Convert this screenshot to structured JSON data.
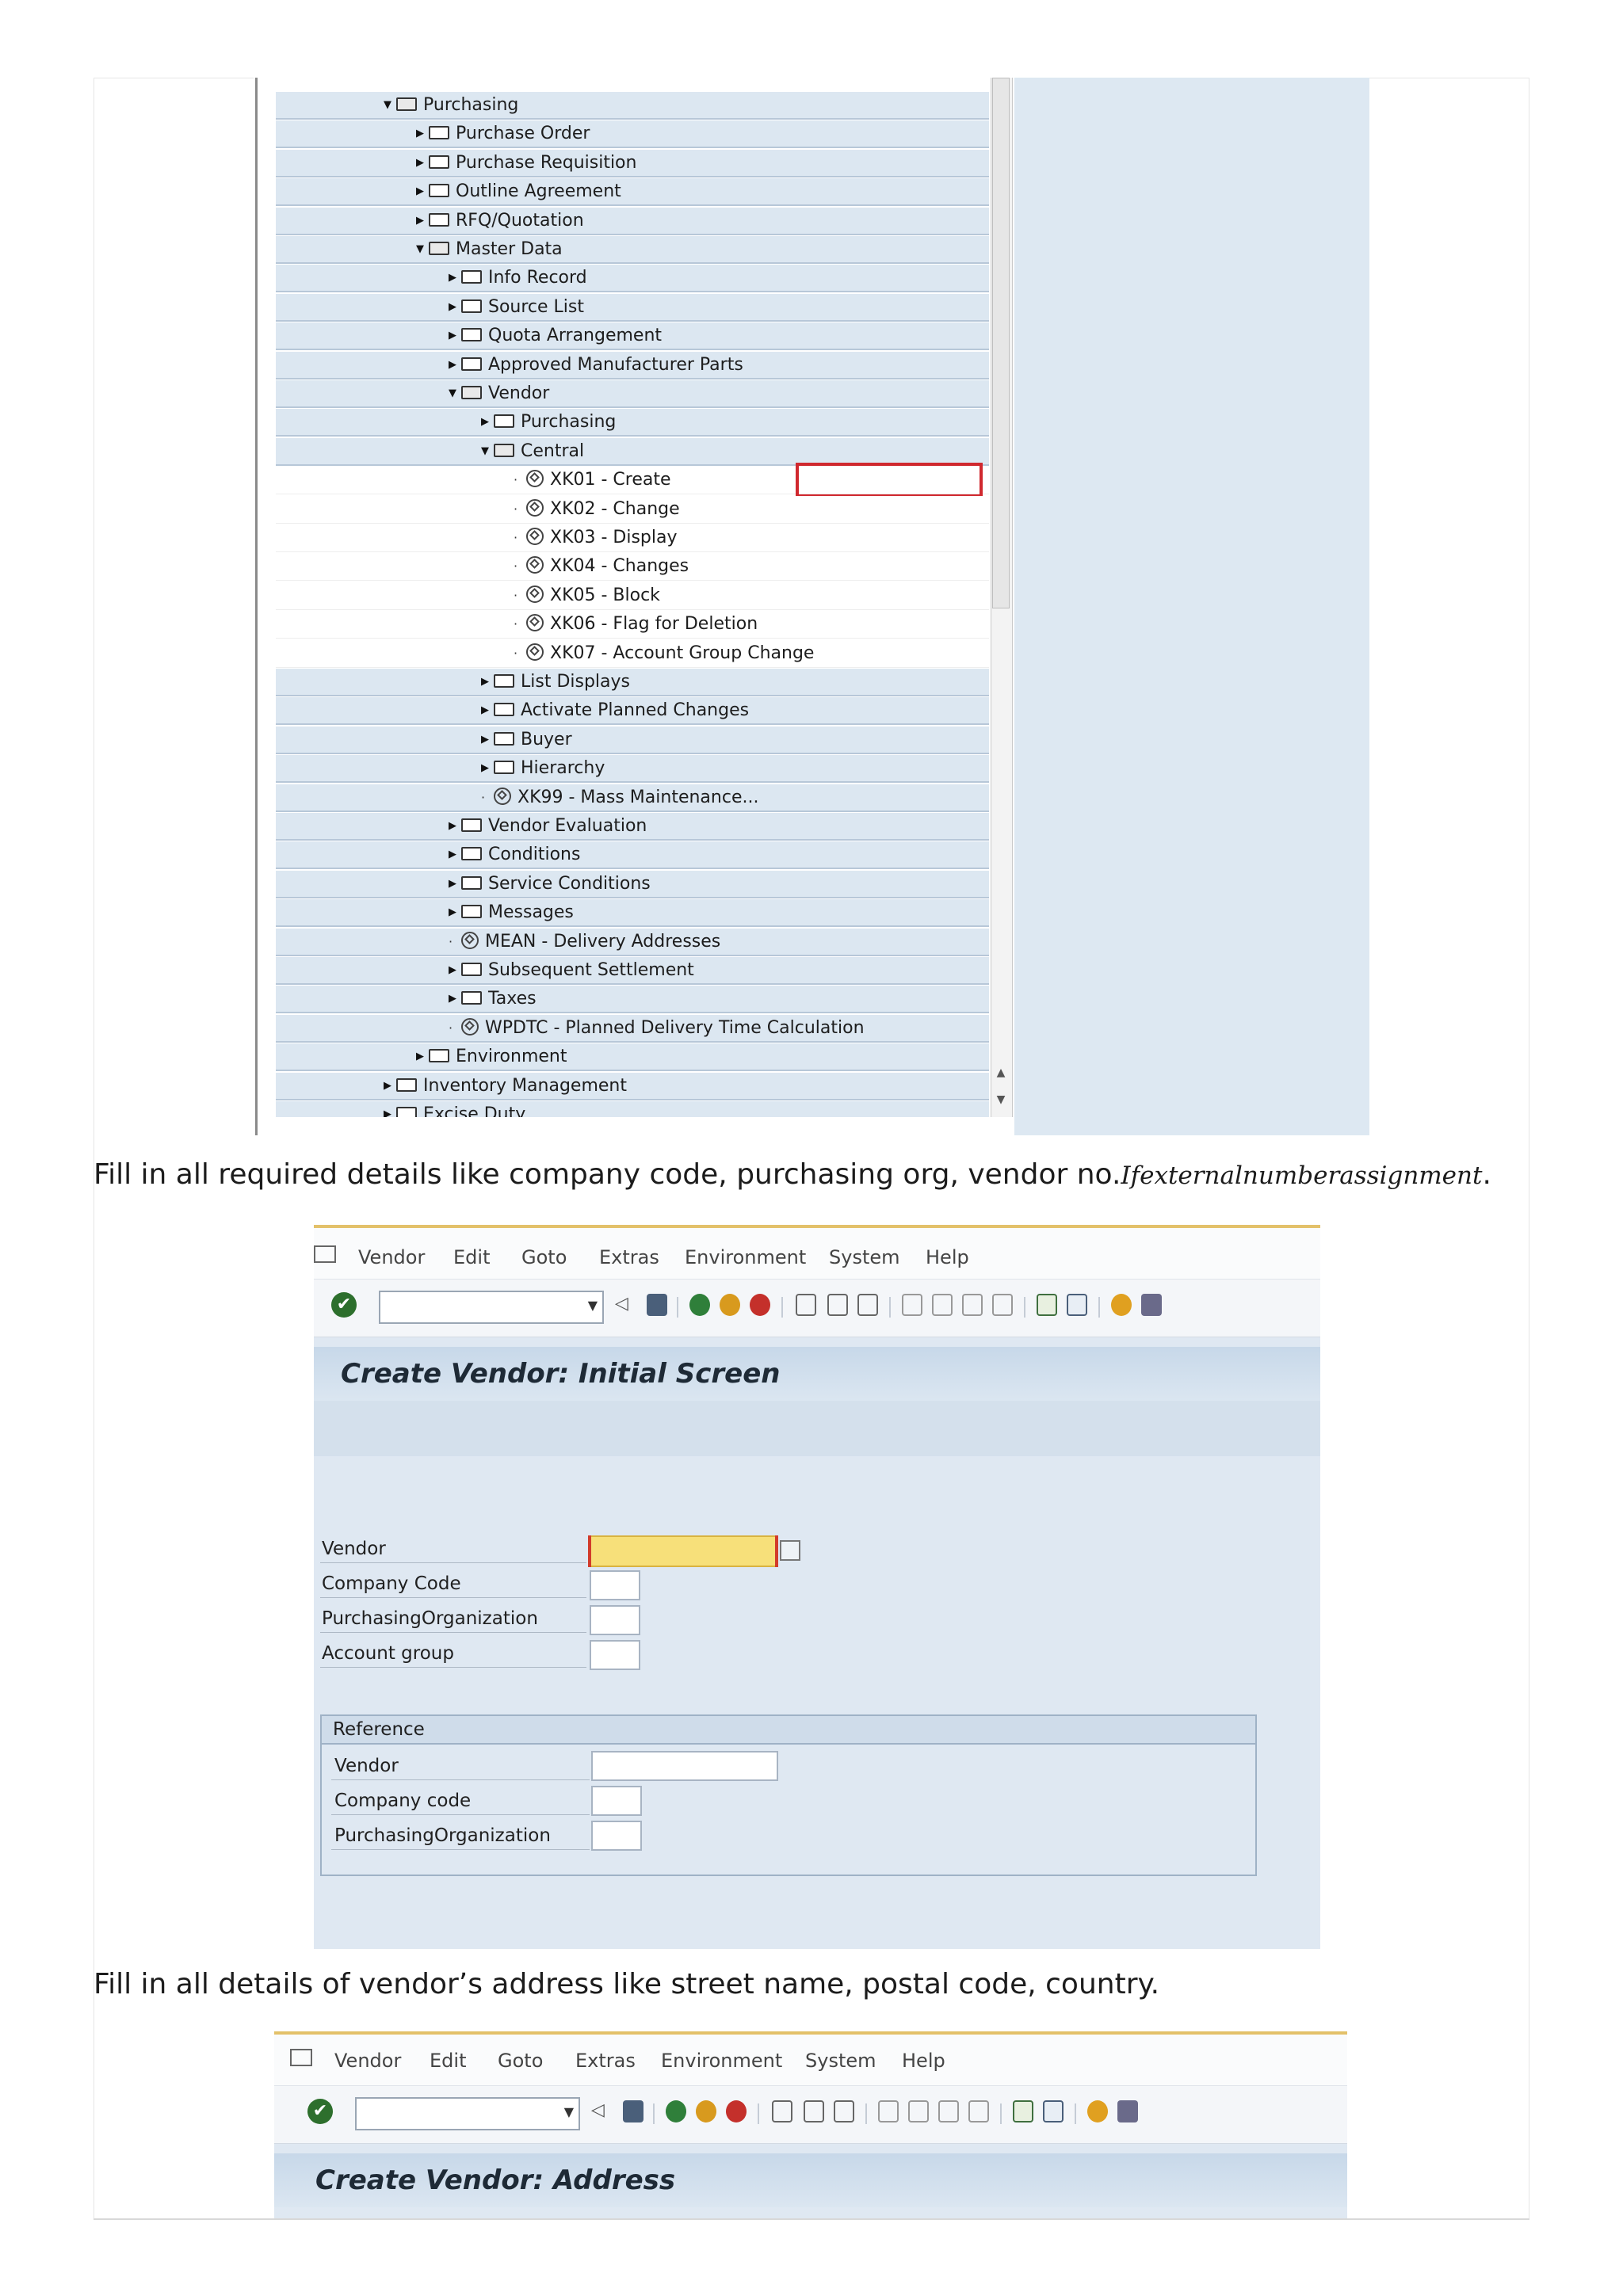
{
  "tree": {
    "items": [
      {
        "label": "Purchasing",
        "expander": "open"
      },
      {
        "label": "Purchase Order",
        "expander": "closed"
      },
      {
        "label": "Purchase Requisition",
        "expander": "closed"
      },
      {
        "label": "Outline Agreement",
        "expander": "closed"
      },
      {
        "label": "RFQ/Quotation",
        "expander": "closed"
      },
      {
        "label": "Master Data",
        "expander": "open"
      },
      {
        "label": "Info Record",
        "expander": "closed"
      },
      {
        "label": "Source List",
        "expander": "closed"
      },
      {
        "label": "Quota Arrangement",
        "expander": "closed"
      },
      {
        "label": "Approved Manufacturer Parts",
        "expander": "closed"
      },
      {
        "label": "Vendor",
        "expander": "open"
      },
      {
        "label": "Purchasing",
        "expander": "closed"
      },
      {
        "label": "Central",
        "expander": "open"
      },
      {
        "label": "XK01 - Create",
        "expander": "transaction",
        "highlighted": true
      },
      {
        "label": "XK02 - Change",
        "expander": "transaction"
      },
      {
        "label": "XK03 - Display",
        "expander": "transaction"
      },
      {
        "label": "XK04 - Changes",
        "expander": "transaction"
      },
      {
        "label": "XK05 - Block",
        "expander": "transaction"
      },
      {
        "label": "XK06 - Flag for Deletion",
        "expander": "transaction"
      },
      {
        "label": "XK07 - Account Group Change",
        "expander": "transaction"
      },
      {
        "label": "List Displays",
        "expander": "closed"
      },
      {
        "label": "Activate Planned Changes",
        "expander": "closed"
      },
      {
        "label": "Buyer",
        "expander": "closed"
      },
      {
        "label": "Hierarchy",
        "expander": "closed"
      },
      {
        "label": "XK99 - Mass Maintenance...",
        "expander": "transaction"
      },
      {
        "label": "Vendor Evaluation",
        "expander": "closed"
      },
      {
        "label": "Conditions",
        "expander": "closed"
      },
      {
        "label": "Service Conditions",
        "expander": "closed"
      },
      {
        "label": "Messages",
        "expander": "closed"
      },
      {
        "label": "MEAN - Delivery Addresses",
        "expander": "transaction"
      },
      {
        "label": "Subsequent Settlement",
        "expander": "closed"
      },
      {
        "label": "Taxes",
        "expander": "closed"
      },
      {
        "label": "WPDTC - Planned Delivery Time Calculation",
        "expander": "transaction"
      },
      {
        "label": "Environment",
        "expander": "closed"
      },
      {
        "label": "Inventory Management",
        "expander": "closed"
      },
      {
        "label": "Excise Duty",
        "expander": "closed"
      }
    ]
  },
  "captions": {
    "first_text": "Fill in all required details like company code, purchasing org, vendor no.",
    "first_italic": "Ifexternalnumberassignment",
    "first_end": ".",
    "second": "Fill in all details of vendor’s address like street name, postal code, country."
  },
  "menu": {
    "vendor": "Vendor",
    "edit": "Edit",
    "goto": "Goto",
    "extras": "Extras",
    "environment": "Environment",
    "system": "System",
    "help": "Help"
  },
  "initial_screen": {
    "title": "Create Vendor:  Initial Screen",
    "fields": {
      "vendor": "Vendor",
      "company_code": "Company Code",
      "purchasing_org": "PurchasingOrganization",
      "account_group": "Account group"
    },
    "reference": {
      "title": "Reference",
      "vendor": "Vendor",
      "company_code": "Company code",
      "purchasing_org": "PurchasingOrganization"
    }
  },
  "address_screen": {
    "title": "Create Vendor: Address"
  },
  "colors": {
    "highlight_box": "#d0282e",
    "required_field": "#f7e07a",
    "sap_background": "#dfe8f2"
  }
}
